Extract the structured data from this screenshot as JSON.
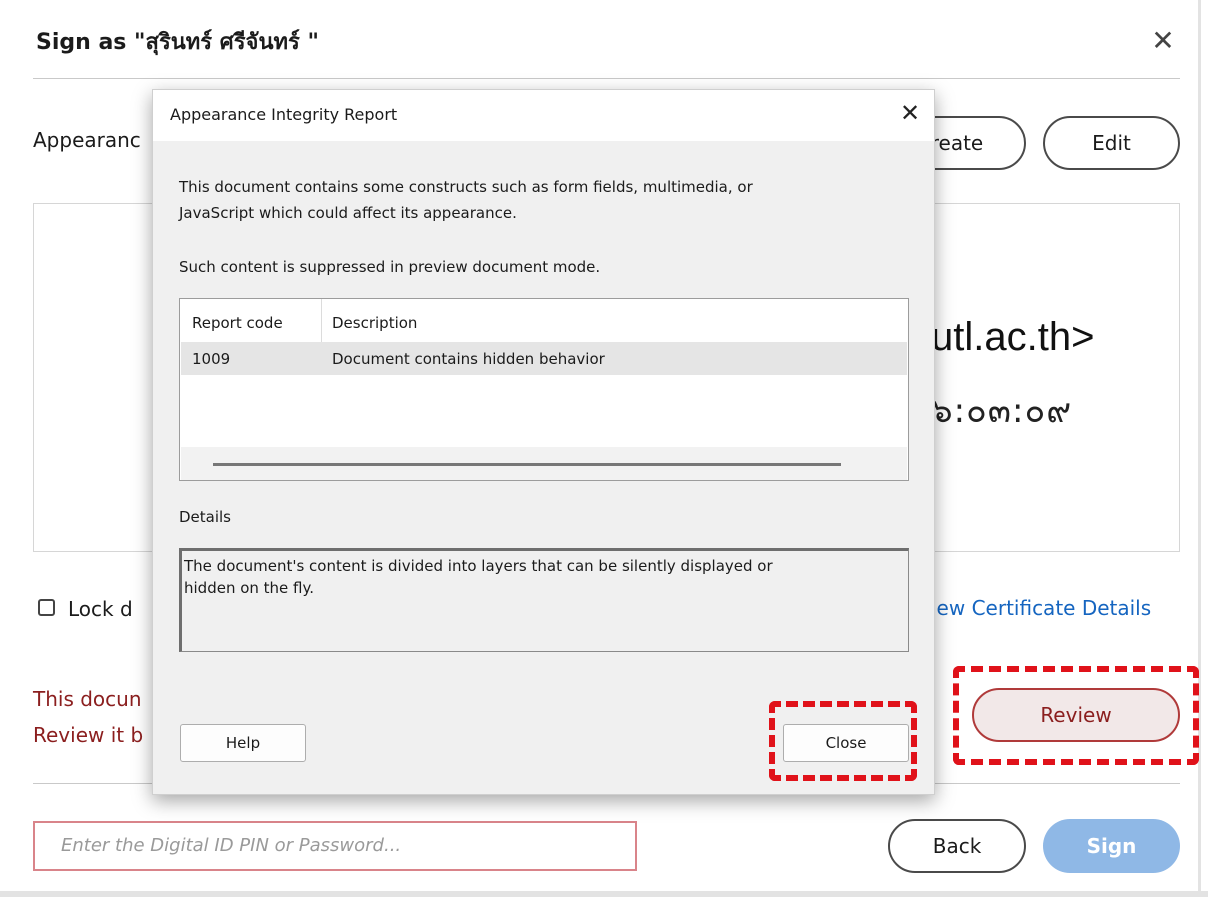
{
  "dialog": {
    "title": "Sign as \"สุรินทร์ ศรีจันทร์ \"",
    "appearance_label": "Appearanc",
    "create_label": "reate",
    "edit_label": "Edit",
    "preview_email": "utl.ac.th>",
    "preview_date": "๖:๐๓:๐๙",
    "lock_label": "Lock d",
    "view_cert_label": "iew Certificate Details",
    "warning_line1": "This docun",
    "warning_line2": "Review it b",
    "review_label": "Review",
    "pin_placeholder": "Enter the Digital ID PIN or Password...",
    "back_label": "Back",
    "sign_label": "Sign",
    "close_glyph": "✕"
  },
  "report": {
    "title": "Appearance Integrity Report",
    "close_glyph": "✕",
    "intro_line1": "This document contains some constructs such as form fields, multimedia, or",
    "intro_line2": "JavaScript which could affect its appearance.",
    "suppressed_text": "Such content is suppressed in preview document mode.",
    "table": {
      "headers": [
        "Report code",
        "Description"
      ],
      "rows": [
        {
          "code": "1009",
          "description": "Document contains hidden behavior"
        }
      ]
    },
    "details_label": "Details",
    "details_line1": "The document's content is divided into layers that can be silently displayed or",
    "details_line2": "hidden on the fly.",
    "help_label": "Help",
    "close_label": "Close"
  },
  "colors": {
    "highlight_dash": "#e0121a",
    "warning_text": "#8b1e1e",
    "link": "#1565c0",
    "sign_button": "#8fb8e6"
  }
}
